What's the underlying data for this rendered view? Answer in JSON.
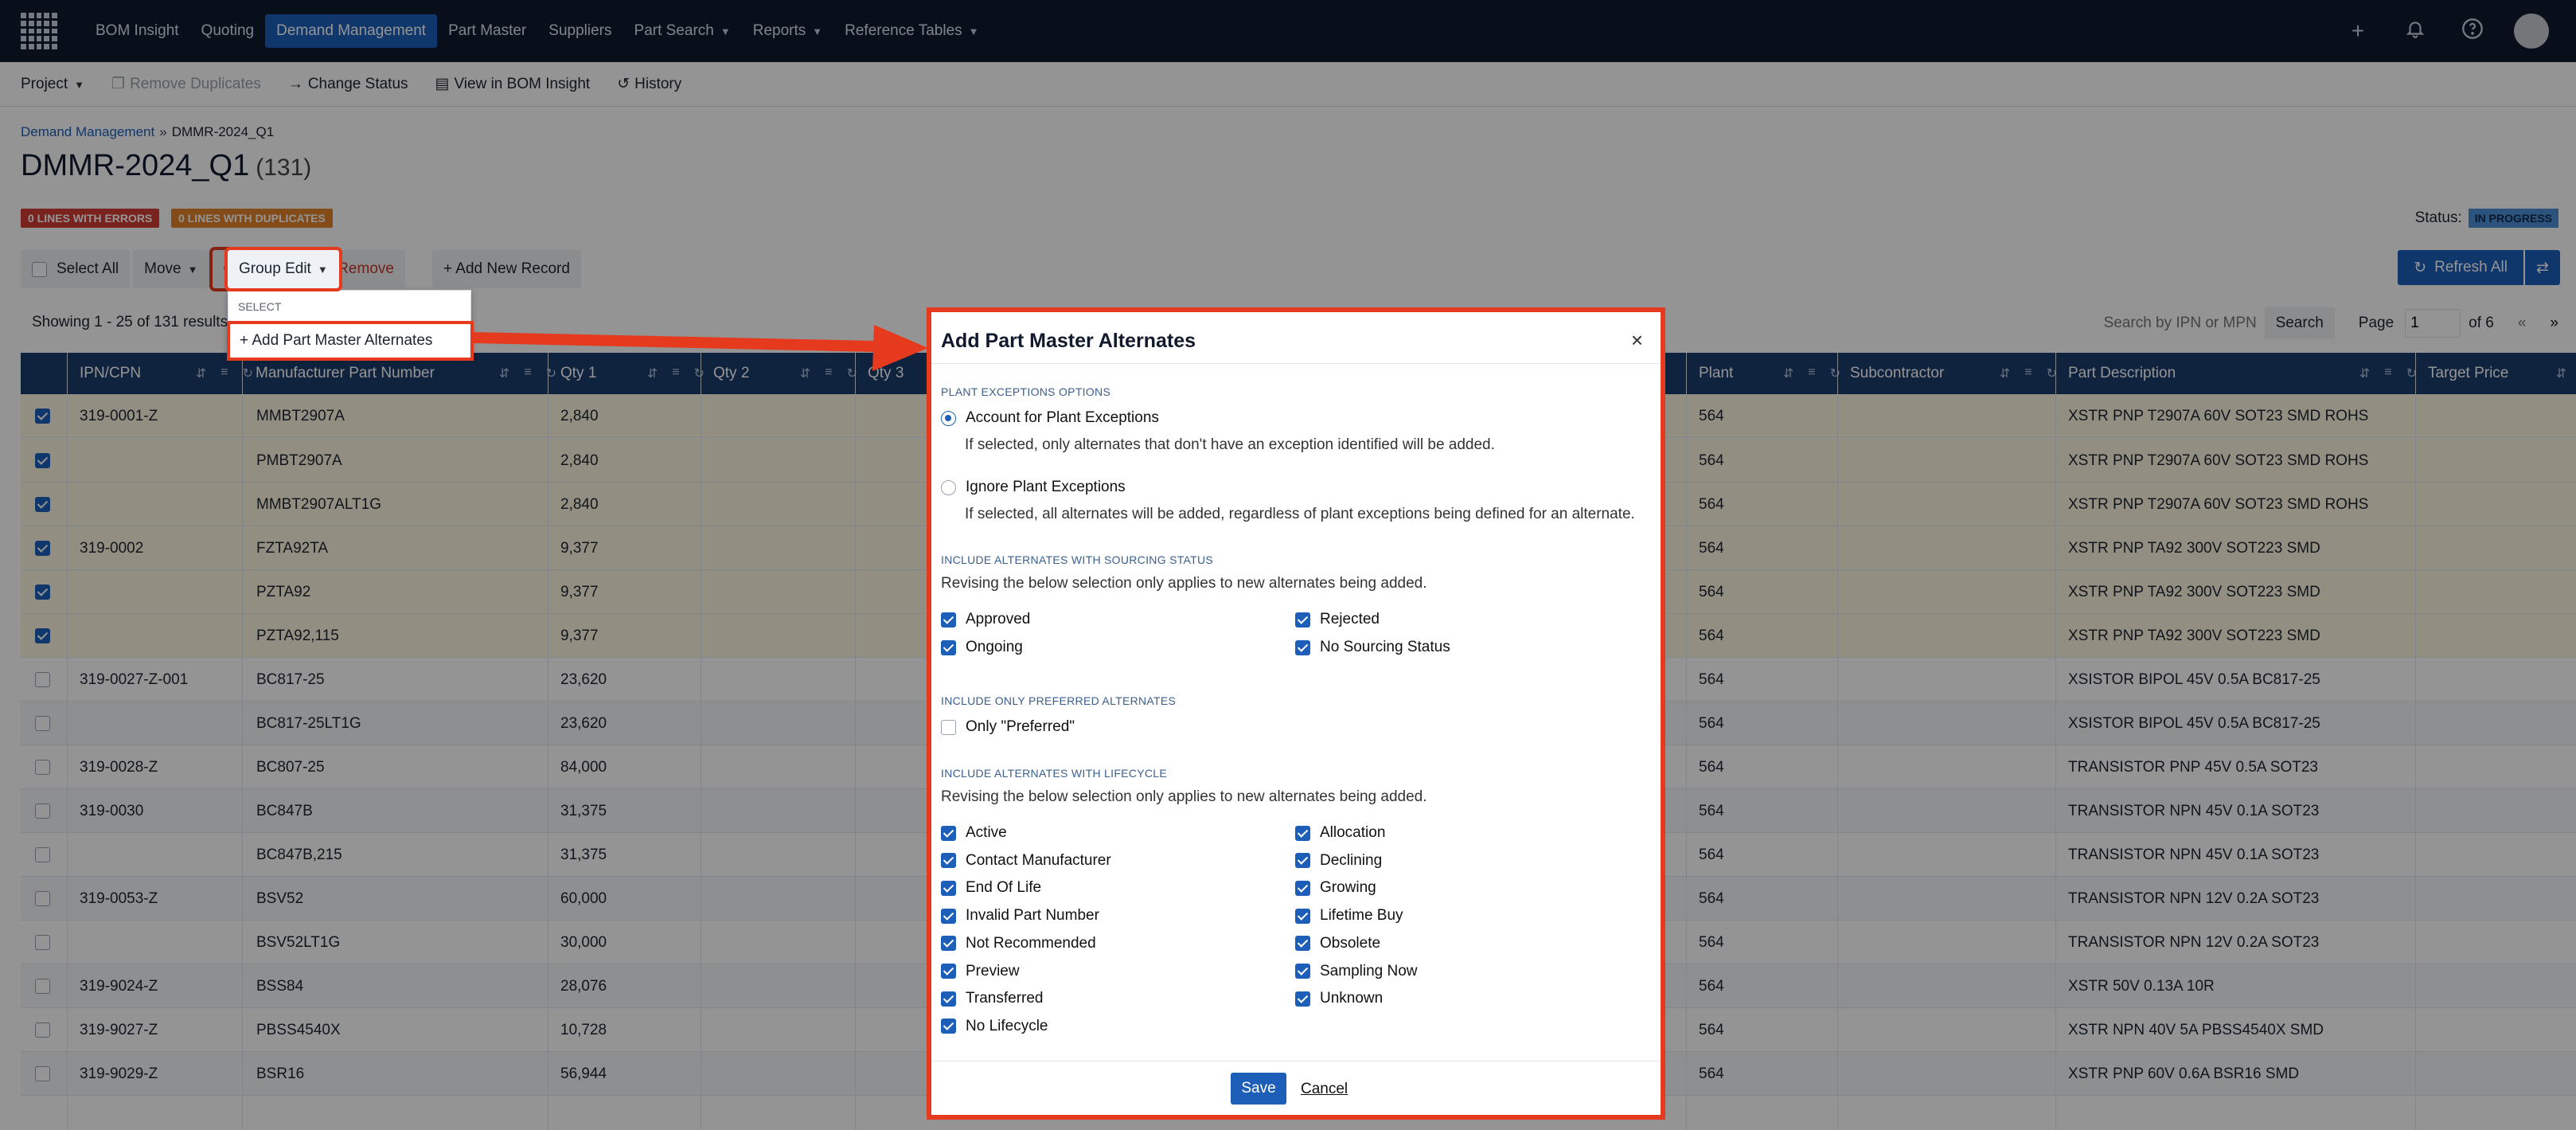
{
  "nav": {
    "items": [
      {
        "label": "BOM Insight",
        "caret": false,
        "active": false
      },
      {
        "label": "Quoting",
        "caret": false,
        "active": false
      },
      {
        "label": "Demand Management",
        "caret": false,
        "active": true
      },
      {
        "label": "Part Master",
        "caret": false,
        "active": false
      },
      {
        "label": "Suppliers",
        "caret": false,
        "active": false
      },
      {
        "label": "Part Search",
        "caret": true,
        "active": false
      },
      {
        "label": "Reports",
        "caret": true,
        "active": false
      },
      {
        "label": "Reference Tables",
        "caret": true,
        "active": false
      }
    ],
    "icons": [
      "plus-icon",
      "bell-icon",
      "help-icon",
      "avatar"
    ]
  },
  "subbar": {
    "project": "Project",
    "remove_duplicates": "Remove Duplicates",
    "change_status": "Change Status",
    "view_in_bom": "View in BOM Insight",
    "history": "History"
  },
  "header": {
    "breadcrumb_link": "Demand Management",
    "breadcrumb_sep": "»",
    "breadcrumb_current": "DMMR-2024_Q1",
    "title": "DMMR-2024_Q1",
    "count": "(131)",
    "errors_badge": "0 LINES WITH ERRORS",
    "duplicates_badge": "0 LINES WITH DUPLICATES",
    "status_label": "Status:",
    "status_value": "IN PROGRESS"
  },
  "toolbar": {
    "select_all": "Select All",
    "move": "Move",
    "group_edit": "Group Edit",
    "remove": "Remove",
    "add_new": "+ Add New Record",
    "refresh_all": "Refresh All"
  },
  "dropdown": {
    "header": "SELECT",
    "item": "+ Add Part Master Alternates"
  },
  "pagination": {
    "showing": "Showing 1 - 25 of 131 results",
    "search_placeholder": "Search by IPN or MPN",
    "search_btn": "Search",
    "page_label": "Page",
    "page_value": "1",
    "of_label": "of 6",
    "prev": "«",
    "next": "»"
  },
  "table": {
    "columns": [
      "IPN/CPN",
      "Manufacturer Part Number",
      "Qty 1",
      "Qty 2",
      "Qty 3",
      "Plant",
      "Subcontractor",
      "Part Description",
      "Target Price"
    ],
    "rows": [
      {
        "selected": true,
        "ipn": "319-0001-Z",
        "mpn": "MMBT2907A",
        "qty1": "2,840",
        "plant": "564",
        "desc": "XSTR PNP T2907A 60V SOT23 SMD ROHS"
      },
      {
        "selected": true,
        "ipn": "",
        "mpn": "PMBT2907A",
        "qty1": "2,840",
        "plant": "564",
        "desc": "XSTR PNP T2907A 60V SOT23 SMD ROHS"
      },
      {
        "selected": true,
        "ipn": "",
        "mpn": "MMBT2907ALT1G",
        "qty1": "2,840",
        "plant": "564",
        "desc": "XSTR PNP T2907A 60V SOT23 SMD ROHS"
      },
      {
        "selected": true,
        "ipn": "319-0002",
        "mpn": "FZTA92TA",
        "qty1": "9,377",
        "plant": "564",
        "desc": "XSTR PNP TA92 300V SOT223 SMD"
      },
      {
        "selected": true,
        "ipn": "",
        "mpn": "PZTA92",
        "qty1": "9,377",
        "plant": "564",
        "desc": "XSTR PNP TA92 300V SOT223 SMD"
      },
      {
        "selected": true,
        "ipn": "",
        "mpn": "PZTA92,115",
        "qty1": "9,377",
        "plant": "564",
        "desc": "XSTR PNP TA92 300V SOT223 SMD"
      },
      {
        "selected": false,
        "ipn": "319-0027-Z-001",
        "mpn": "BC817-25",
        "qty1": "23,620",
        "plant": "564",
        "desc": "XSISTOR BIPOL 45V 0.5A BC817-25"
      },
      {
        "selected": false,
        "ipn": "",
        "mpn": "BC817-25LT1G",
        "qty1": "23,620",
        "plant": "564",
        "desc": "XSISTOR BIPOL 45V 0.5A BC817-25"
      },
      {
        "selected": false,
        "ipn": "319-0028-Z",
        "mpn": "BC807-25",
        "qty1": "84,000",
        "plant": "564",
        "desc": "TRANSISTOR PNP 45V 0.5A SOT23"
      },
      {
        "selected": false,
        "ipn": "319-0030",
        "mpn": "BC847B",
        "qty1": "31,375",
        "plant": "564",
        "desc": "TRANSISTOR NPN 45V 0.1A SOT23"
      },
      {
        "selected": false,
        "ipn": "",
        "mpn": "BC847B,215",
        "qty1": "31,375",
        "plant": "564",
        "desc": "TRANSISTOR NPN 45V 0.1A SOT23"
      },
      {
        "selected": false,
        "ipn": "319-0053-Z",
        "mpn": "BSV52",
        "qty1": "60,000",
        "plant": "564",
        "desc": "TRANSISTOR NPN 12V 0.2A SOT23"
      },
      {
        "selected": false,
        "ipn": "",
        "mpn": "BSV52LT1G",
        "qty1": "30,000",
        "plant": "564",
        "desc": "TRANSISTOR NPN 12V 0.2A SOT23"
      },
      {
        "selected": false,
        "ipn": "319-9024-Z",
        "mpn": "BSS84",
        "qty1": "28,076",
        "plant": "564",
        "desc": "XSTR 50V 0.13A 10R"
      },
      {
        "selected": false,
        "ipn": "319-9027-Z",
        "mpn": "PBSS4540X",
        "qty1": "10,728",
        "plant": "564",
        "desc": "XSTR NPN 40V 5A PBSS4540X SMD"
      },
      {
        "selected": false,
        "ipn": "319-9029-Z",
        "mpn": "BSR16",
        "qty1": "56,944",
        "plant": "564",
        "desc": "XSTR PNP 60V 0.6A BSR16 SMD"
      }
    ]
  },
  "modal": {
    "title": "Add Part Master Alternates",
    "close": "×",
    "plant_section": "PLANT EXCEPTIONS OPTIONS",
    "plant_opt1": "Account for Plant Exceptions",
    "plant_opt1_desc": "If selected, only alternates that don't have an exception identified will be added.",
    "plant_opt2": "Ignore Plant Exceptions",
    "plant_opt2_desc": "If selected, all alternates will be added, regardless of plant exceptions being defined for an alternate.",
    "sourcing_section": "INCLUDE ALTERNATES WITH SOURCING STATUS",
    "sourcing_note": "Revising the below selection only applies to new alternates being added.",
    "sourcing_left": [
      "Approved",
      "Ongoing"
    ],
    "sourcing_right": [
      "Rejected",
      "No Sourcing Status"
    ],
    "preferred_section": "INCLUDE ONLY PREFERRED ALTERNATES",
    "preferred_opt": "Only \"Preferred\"",
    "lifecycle_section": "INCLUDE ALTERNATES WITH LIFECYCLE",
    "lifecycle_note": "Revising the below selection only applies to new alternates being added.",
    "lifecycle_left": [
      "Active",
      "Contact Manufacturer",
      "End Of Life",
      "Invalid Part Number",
      "Not Recommended",
      "Preview",
      "Transferred",
      "No Lifecycle"
    ],
    "lifecycle_right": [
      "Allocation",
      "Declining",
      "Growing",
      "Lifetime Buy",
      "Obsolete",
      "Sampling Now",
      "Unknown"
    ],
    "save": "Save",
    "cancel": "Cancel"
  },
  "colors": {
    "nav_bg": "#111a2d",
    "accent": "#1d5fb8",
    "highlight": "#e53a1e",
    "error_badge": "#d33c32",
    "duplicate_badge": "#e1822a"
  }
}
